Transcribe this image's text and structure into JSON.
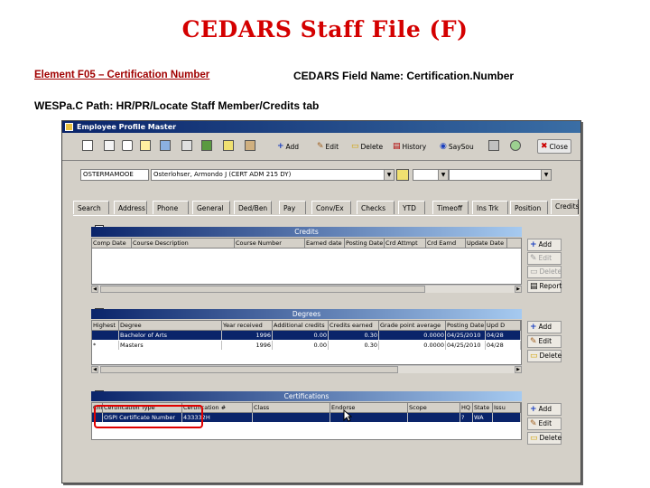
{
  "slide": {
    "title": "CEDARS Staff File (F)",
    "element_label": "Element F05 – Certification Number",
    "field_name": "CEDARS Field Name: Certification.Number",
    "path": "WESPa.C Path: HR/PR/Locate Staff Member/Credits tab"
  },
  "window": {
    "title": "Employee Profile Master",
    "toolbar": {
      "add": "Add",
      "edit": "Edit",
      "delete": "Delete",
      "history": "History",
      "save": "SaySou",
      "close": "Close"
    },
    "employee_id": "OSTERMAMOOE",
    "employee_name": "Osterlohser, Armondo J (CERT ADM 215 DY)",
    "tabs": [
      "Search",
      "Address",
      "Phone",
      "General",
      "Ded/Ben",
      "Pay",
      "Conv/Ex",
      "Checks",
      "YTD",
      "Timeoff",
      "Ins Trk",
      "Position",
      "Credits"
    ],
    "active_tab": "Credits",
    "credits": {
      "title": "Credits",
      "columns": [
        "Comp Date",
        "Course Description",
        "Course Number",
        "Earned date",
        "Posting Date",
        "Crd Attmpt",
        "Crd Earnd",
        "Update Date"
      ],
      "buttons": {
        "add": "Add",
        "edit": "Edit",
        "delete": "Delete",
        "report": "Report"
      }
    },
    "degrees": {
      "title": "Degrees",
      "columns": [
        "Highest",
        "Degree",
        "Year received",
        "Additional credits",
        "Credits earned",
        "Grade point average",
        "Posting Date",
        "Upd D"
      ],
      "rows": [
        {
          "highest": "",
          "degree": "Bachelor of Arts",
          "year": "1996",
          "additional": "0.00",
          "earned": "0.30",
          "gpa": "0.0000",
          "posting": "04/25/2010",
          "upd": "04/28"
        },
        {
          "highest": "*",
          "degree": "Masters",
          "year": "1996",
          "additional": "0.00",
          "earned": "0.30",
          "gpa": "0.0000",
          "posting": "04/25/2010",
          "upd": "04/28"
        }
      ],
      "buttons": {
        "add": "Add",
        "edit": "Edit",
        "delete": "Delete"
      }
    },
    "certifications": {
      "title": "Certifications",
      "columns": [
        "Cnt",
        "Certification Type",
        "Certification #",
        "Class",
        "Endorse",
        "Scope",
        "HQ",
        "State",
        "Issu"
      ],
      "rows": [
        {
          "cnt": "",
          "type": "OSPI Certificate Number",
          "number": "433332H",
          "class": "",
          "endorse": "",
          "scope": "",
          "hq": "?",
          "state": "WA",
          "issue": ""
        }
      ],
      "buttons": {
        "add": "Add",
        "edit": "Edit",
        "delete": "Delete"
      }
    }
  },
  "colors": {
    "title_red": "#d40000",
    "highlight_red": "#e00000",
    "selection": "#0a246a"
  }
}
